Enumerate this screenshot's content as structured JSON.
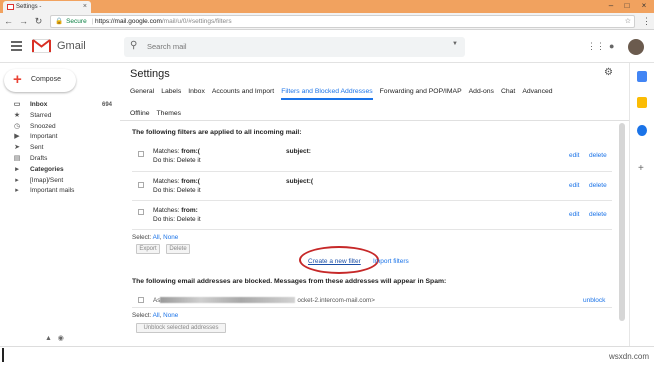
{
  "browser": {
    "tab_title": "Settings -",
    "tab_close": "×",
    "window_min": "–",
    "window_max": "□",
    "window_close": "×",
    "secure_label": "Secure",
    "url_main": "https://mail.google.com",
    "url_rest": "/mail/u/0/#settings/filters",
    "back": "←",
    "forward": "→",
    "reload": "↻"
  },
  "header": {
    "app_name": "Gmail",
    "search_placeholder": "Search mail",
    "search_dropdown": "▼"
  },
  "compose": {
    "label": "Compose",
    "plus": "+"
  },
  "nav": [
    {
      "icon": "inbox-icon",
      "glyph": "▭",
      "label": "Inbox",
      "count": "694",
      "bold": true
    },
    {
      "icon": "star-icon",
      "glyph": "★",
      "label": "Starred",
      "count": "",
      "bold": false
    },
    {
      "icon": "clock-icon",
      "glyph": "◷",
      "label": "Snoozed",
      "count": "",
      "bold": false
    },
    {
      "icon": "important-icon",
      "glyph": "▶",
      "label": "Important",
      "count": "",
      "bold": false
    },
    {
      "icon": "send-icon",
      "glyph": "➤",
      "label": "Sent",
      "count": "",
      "bold": false
    },
    {
      "icon": "draft-icon",
      "glyph": "▤",
      "label": "Drafts",
      "count": "",
      "bold": false
    },
    {
      "icon": "label-icon",
      "glyph": "▸",
      "label": "Categories",
      "count": "",
      "bold": true
    },
    {
      "icon": "label-icon",
      "glyph": "▸",
      "label": "[Imap]/Sent",
      "count": "",
      "bold": false
    },
    {
      "icon": "label-icon",
      "glyph": "▸",
      "label": "Important mails",
      "count": "",
      "bold": false
    }
  ],
  "settings": {
    "title": "Settings",
    "tabs_row1": [
      "General",
      "Labels",
      "Inbox",
      "Accounts and Import",
      "Filters and Blocked Addresses",
      "Forwarding and POP/IMAP",
      "Add-ons",
      "Chat",
      "Advanced"
    ],
    "active_tab": "Filters and Blocked Addresses",
    "tabs_row2": [
      "Offline",
      "Themes"
    ],
    "filters_heading": "The following filters are applied to all incoming mail:",
    "filters": [
      {
        "matches_label": "Matches:",
        "from_label": "from:(",
        "action": "Do this: Delete it",
        "subject_label": "subject:",
        "edit": "edit",
        "delete": "delete"
      },
      {
        "matches_label": "Matches:",
        "from_label": "from:(",
        "action": "Do this: Delete it",
        "subject_label": "subject:(",
        "edit": "edit",
        "delete": "delete"
      },
      {
        "matches_label": "Matches:",
        "from_label": "from:",
        "action": "Do this: Delete it",
        "subject_label": "",
        "edit": "edit",
        "delete": "delete"
      }
    ],
    "select_label": "Select:",
    "select_all": "All",
    "select_none": "None",
    "export_btn": "Export",
    "delete_btn": "Delete",
    "create_filter": "Create a new filter",
    "import_filters": "Import filters",
    "blocked_heading": "The following email addresses are blocked. Messages from these addresses will appear in Spam:",
    "blocked_address_prefix": "As",
    "blocked_address_suffix": "ocket-2.intercom-mail.com>",
    "unblock": "unblock",
    "unblock_btn": "Unblock selected addresses"
  },
  "footer": {
    "watermark": "wsxdn.com"
  }
}
